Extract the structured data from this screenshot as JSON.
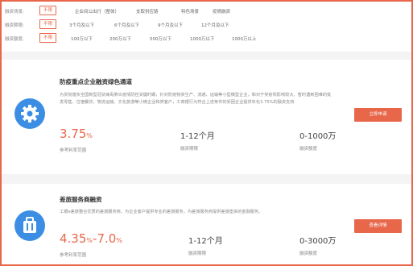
{
  "filters": [
    {
      "label": "融资场景:",
      "options": [
        "不限",
        "企业间公出行（整体）",
        "支取供应链",
        "特色场景",
        "疫情融资"
      ]
    },
    {
      "label": "融资期限:",
      "options": [
        "不限",
        "3个月及以下",
        "6个月及以下",
        "9个月及以下",
        "12个月及以下"
      ]
    },
    {
      "label": "融资额度:",
      "options": [
        "不限",
        "100万以下",
        "200万以下",
        "500万以下",
        "1000万以下",
        "1000万以上"
      ]
    }
  ],
  "products": [
    {
      "icon": "gear-icon",
      "title": "防疫重点企业融资绿色通道",
      "description": "为贯彻落实全国新型冠状病毒肺炎疫情防控关键时期，针对防疫物资生产、流通、运输等小型微型企业，和对于受疫情影响较大、暂时遇到困难的批发零售、住宿餐饮、物流运输、文化旅游等小微企业和类客户，工商银行为符合上述条件的受困企业提供年化3.75%的融资支持",
      "rate": "3.75",
      "rate_unit": "%",
      "rate_caption": "参考利率范围",
      "term": "1-12个月",
      "term_caption": "融资期限",
      "amount": "0-1000万",
      "amount_caption": "融资额度",
      "button": "立即申请"
    },
    {
      "icon": "suitcase-icon",
      "title": "差旅服务商融资",
      "description": "工银e差旅整合优质的差旅服务商，为企业客户提供专业的差旅服务，为差旅服务商提供差旅垫资的金融服务。",
      "rate": "4.35",
      "rate_unit": "%",
      "rate_max": "7.0",
      "rate_caption": "参考利率范围",
      "term": "1-12个月",
      "term_caption": "融资期限",
      "amount": "0-3000万",
      "amount_caption": "融资额度",
      "button": "查看详情"
    }
  ],
  "colors": {
    "accent": "#e8674a",
    "icon_bg": "#3b8ee3",
    "page_bg": "#f4f4f4"
  }
}
